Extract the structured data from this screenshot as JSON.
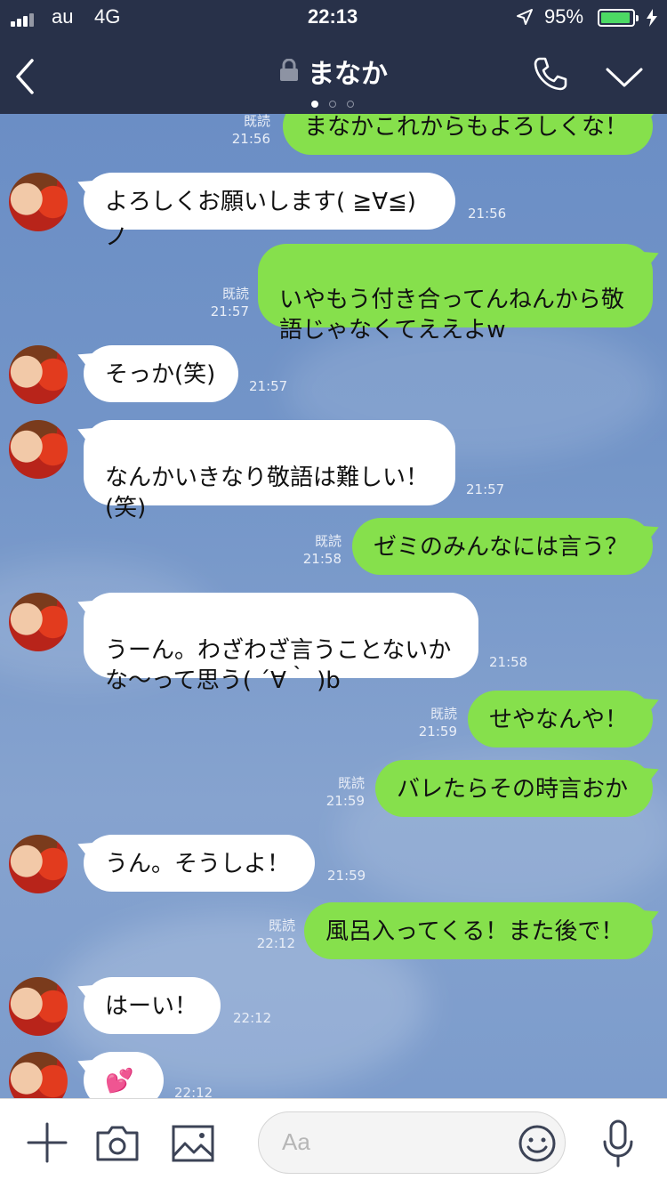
{
  "status_bar": {
    "carrier": "au",
    "network": "4G",
    "time": "22:13",
    "battery_percent": "95%",
    "battery_level": 0.95,
    "icons": [
      "signal-icon",
      "location-arrow-icon",
      "battery-icon",
      "charging-bolt-icon"
    ]
  },
  "nav": {
    "title": "まなか",
    "icons": [
      "back-chevron-icon",
      "lock-icon",
      "phone-icon",
      "chevron-down-icon"
    ],
    "page_dots": 3,
    "active_dot": 1
  },
  "messages": [
    {
      "side": "out",
      "text": "まなかこれからもよろしくな！",
      "read": "既読",
      "time": "21:56"
    },
    {
      "side": "in",
      "text": "よろしくお願いします( ≧∀≦)ノ",
      "time": "21:56"
    },
    {
      "side": "out",
      "text": "いやもう付き合ってんねんから敬\n語じゃなくてええよw",
      "read": "既読",
      "time": "21:57"
    },
    {
      "side": "in",
      "text": "そっか(笑)",
      "time": "21:57"
    },
    {
      "side": "in",
      "text": "なんかいきなり敬語は難しい！\n(笑)",
      "time": "21:57"
    },
    {
      "side": "out",
      "text": "ゼミのみんなには言う？",
      "read": "既読",
      "time": "21:58"
    },
    {
      "side": "in",
      "text": "うーん。わざわざ言うことないか\nな〜って思う( ´∀｀ )b",
      "time": "21:58"
    },
    {
      "side": "out",
      "text": "せやなんや！",
      "read": "既読",
      "time": "21:59"
    },
    {
      "side": "out",
      "text": "バレたらその時言おか",
      "read": "既読",
      "time": "21:59"
    },
    {
      "side": "in",
      "text": "うん。そうしよ！",
      "time": "21:59"
    },
    {
      "side": "out",
      "text": "風呂入ってくる！また後で！",
      "read": "既読",
      "time": "22:12"
    },
    {
      "side": "in",
      "text": "はーい！",
      "time": "22:12"
    },
    {
      "side": "in",
      "text": "💕",
      "time": "22:12"
    }
  ],
  "input": {
    "placeholder": "Aa",
    "icons": [
      "plus-icon",
      "camera-icon",
      "image-icon",
      "emoji-icon",
      "microphone-icon"
    ]
  },
  "colors": {
    "header": "#283149",
    "outgoing_bubble": "#86e04c",
    "incoming_bubble": "#ffffff",
    "chat_background": "#7395c8"
  }
}
